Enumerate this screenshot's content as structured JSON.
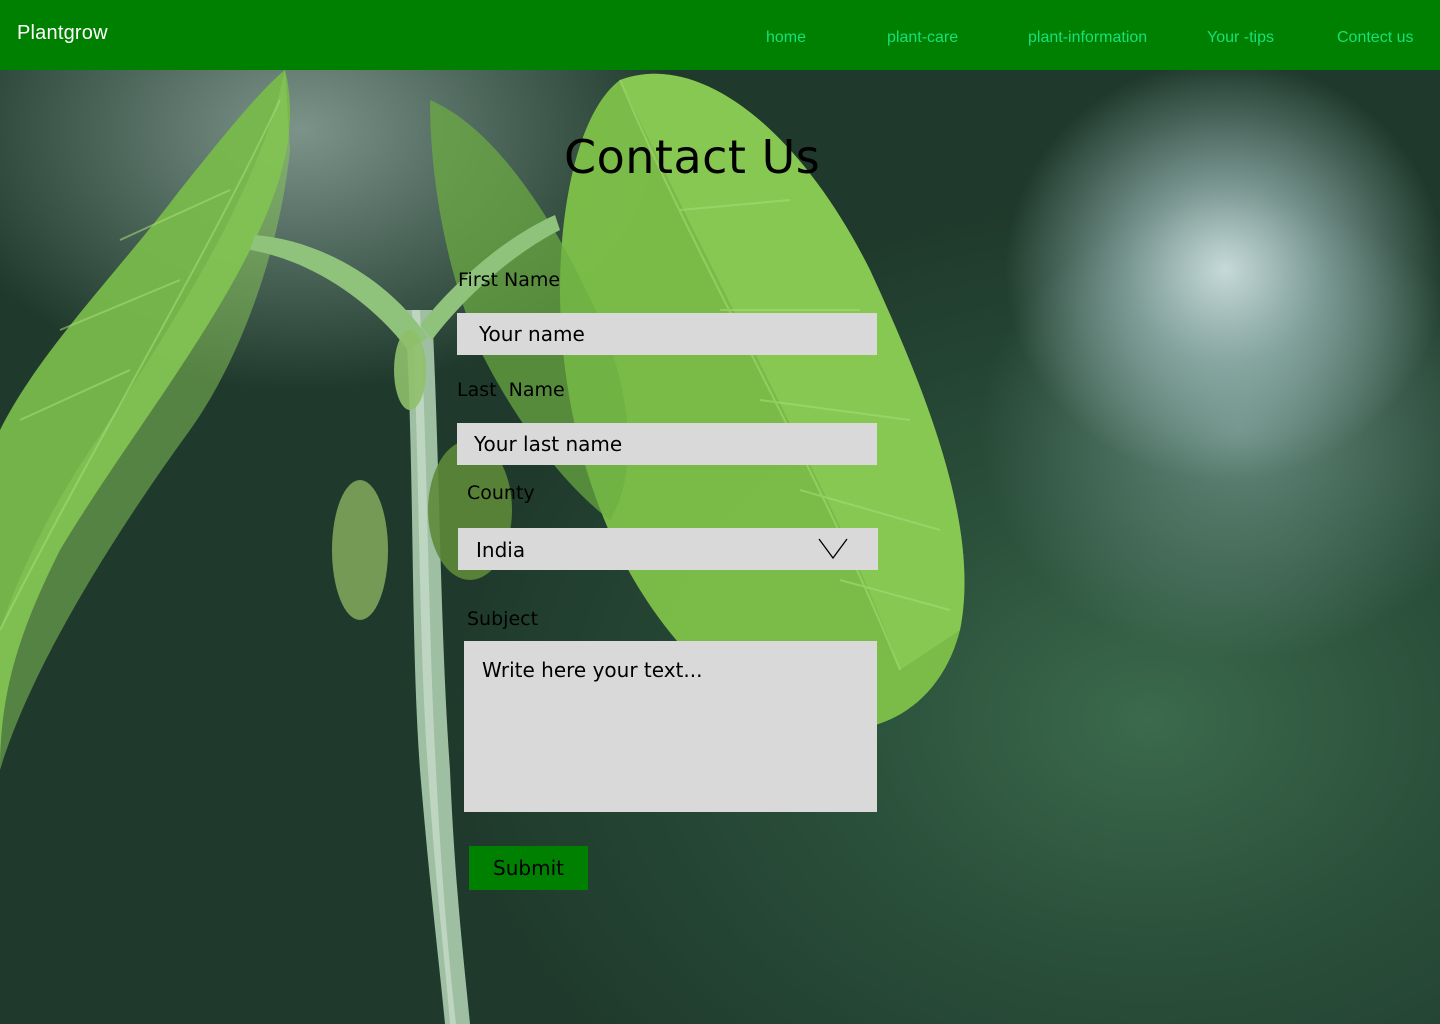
{
  "nav": {
    "brand": "Plantgrow",
    "links": [
      {
        "label": "home"
      },
      {
        "label": "plant-care"
      },
      {
        "label": "plant-information"
      },
      {
        "label": "Your -tips"
      },
      {
        "label": "Contect us"
      }
    ]
  },
  "page": {
    "title": "Contact Us"
  },
  "form": {
    "first_name": {
      "label": "First Name",
      "placeholder": "Your name"
    },
    "last_name": {
      "label": "Last  Name",
      "placeholder": "Your last name"
    },
    "county": {
      "label": "County",
      "value": "India"
    },
    "subject": {
      "label": "Subject",
      "placeholder": "Write here your text..."
    },
    "submit_label": "Submit"
  },
  "colors": {
    "nav_bg": "#008000",
    "nav_link": "#16e07a",
    "field_bg": "#d9d9d9",
    "button_bg": "#008000"
  },
  "icons": {
    "select_toggle": "chevron-down-icon"
  }
}
